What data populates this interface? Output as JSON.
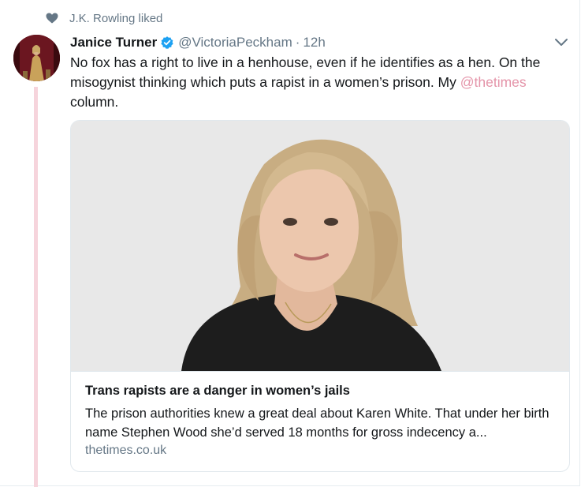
{
  "social_context": {
    "text": "J.K. Rowling liked",
    "icon": "heart-icon"
  },
  "tweet": {
    "author_name": "Janice Turner",
    "verified_icon": "verified-badge-icon",
    "handle": "@VictoriaPeckham",
    "separator": "·",
    "timestamp": "12h",
    "text_before": "No fox has a right to live in a henhouse, even if he identifies as a hen. On the misogynist thinking which puts a rapist in a women’s prison. My ",
    "mention": "@thetimes",
    "text_after": " column.",
    "menu_icon": "chevron-down-icon"
  },
  "card": {
    "title": "Trans rapists are a danger in women’s jails",
    "description": "The prison authorities knew a great deal about Karen White. That under her birth name Stephen Wood she’d served 18 months for gross indecency a...",
    "domain": "thetimes.co.uk"
  },
  "colors": {
    "accent": "#e493a8",
    "thread_line": "#f6d4dc",
    "secondary_text": "#657786",
    "verified": "#1da1f2"
  }
}
